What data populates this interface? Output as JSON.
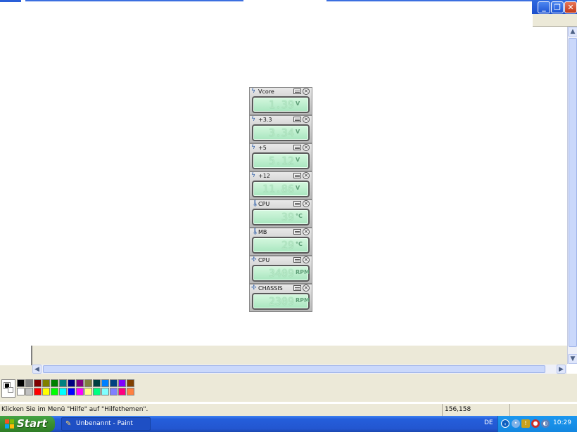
{
  "window": {
    "minimize_label": "_",
    "maximize_label": "❐",
    "close_label": "✕"
  },
  "gadgets": [
    {
      "label": "Vcore",
      "type_icon": "voltage-icon",
      "digits": "1.39",
      "unit": "V"
    },
    {
      "label": "+3.3",
      "type_icon": "voltage-icon",
      "digits": "3.34",
      "unit": "V"
    },
    {
      "label": "+5",
      "type_icon": "voltage-icon",
      "digits": "5.12",
      "unit": "V"
    },
    {
      "label": "+12",
      "type_icon": "voltage-icon",
      "digits": "11.86",
      "unit": "V"
    },
    {
      "label": "CPU",
      "type_icon": "thermometer-icon",
      "digits": "39",
      "unit": "°C"
    },
    {
      "label": "MB",
      "type_icon": "thermometer-icon",
      "digits": "29",
      "unit": "°C"
    },
    {
      "label": "CPU",
      "type_icon": "fan-icon",
      "digits": "3409",
      "unit": "RPM"
    },
    {
      "label": "CHASSIS",
      "type_icon": "fan-icon",
      "digits": "2309",
      "unit": "RPM"
    }
  ],
  "palette": {
    "colors": [
      "#000000",
      "#808080",
      "#800000",
      "#808000",
      "#008000",
      "#008080",
      "#000080",
      "#800080",
      "#808040",
      "#004040",
      "#0080ff",
      "#004080",
      "#8000ff",
      "#804000",
      "#ffffff",
      "#c0c0c0",
      "#ff0000",
      "#ffff00",
      "#00ff00",
      "#00ffff",
      "#0000ff",
      "#ff00ff",
      "#ffff80",
      "#00ff80",
      "#80ffff",
      "#8080ff",
      "#ff0080",
      "#ff8040"
    ],
    "foreground": "#000000",
    "background": "#ffffff"
  },
  "statusbar": {
    "message": "Klicken Sie im Menü \"Hilfe\" auf \"Hilfethemen\".",
    "coords": "156,158"
  },
  "taskbar": {
    "start_label": "Start",
    "task_label": "Unbenannt - Paint",
    "language": "DE",
    "clock": "10:29"
  }
}
